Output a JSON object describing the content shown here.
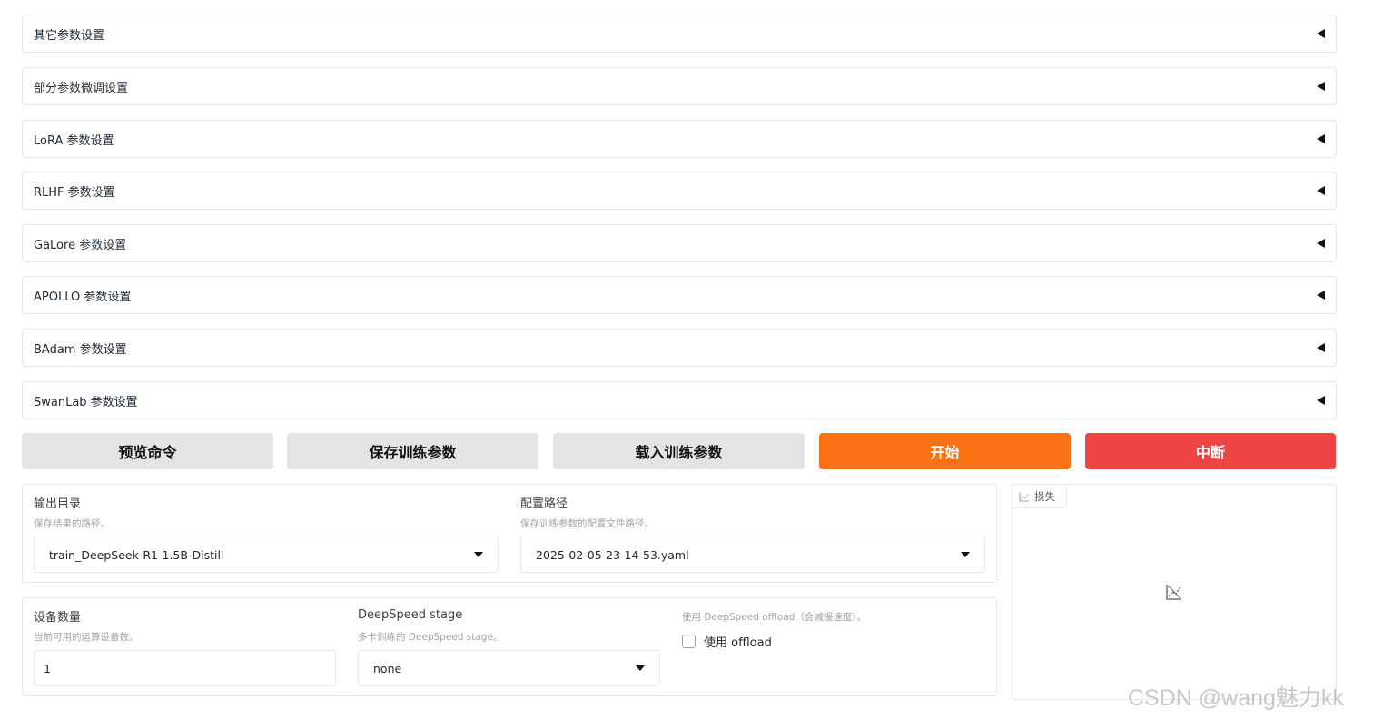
{
  "accordions": [
    {
      "label": "其它参数设置"
    },
    {
      "label": "部分参数微调设置"
    },
    {
      "label": "LoRA 参数设置"
    },
    {
      "label": "RLHF 参数设置"
    },
    {
      "label": "GaLore 参数设置"
    },
    {
      "label": "APOLLO 参数设置"
    },
    {
      "label": "BAdam 参数设置"
    },
    {
      "label": "SwanLab 参数设置"
    }
  ],
  "actions": {
    "preview": "预览命令",
    "save": "保存训练参数",
    "load": "载入训练参数",
    "start": "开始",
    "abort": "中断"
  },
  "output_dir": {
    "label": "输出目录",
    "info": "保存结果的路径。",
    "value": "train_DeepSeek-R1-1.5B-Distill"
  },
  "config_path": {
    "label": "配置路径",
    "info": "保存训练参数的配置文件路径。",
    "value": "2025-02-05-23-14-53.yaml"
  },
  "device_count": {
    "label": "设备数量",
    "info": "当前可用的运算设备数。",
    "value": "1"
  },
  "ds_stage": {
    "label": "DeepSpeed stage",
    "info": "多卡训练的 DeepSpeed stage。",
    "value": "none"
  },
  "ds_offload": {
    "info": "使用 DeepSpeed offload（会减慢速度）。",
    "checkbox_label": "使用 offload",
    "checked": false
  },
  "loss_plot": {
    "tab_label": "损失",
    "icon": "chart-icon"
  },
  "watermark": "CSDN @wang魅力kk",
  "colors": {
    "start": "#f97316",
    "abort": "#ef4444",
    "secondary": "#e4e4e7"
  }
}
